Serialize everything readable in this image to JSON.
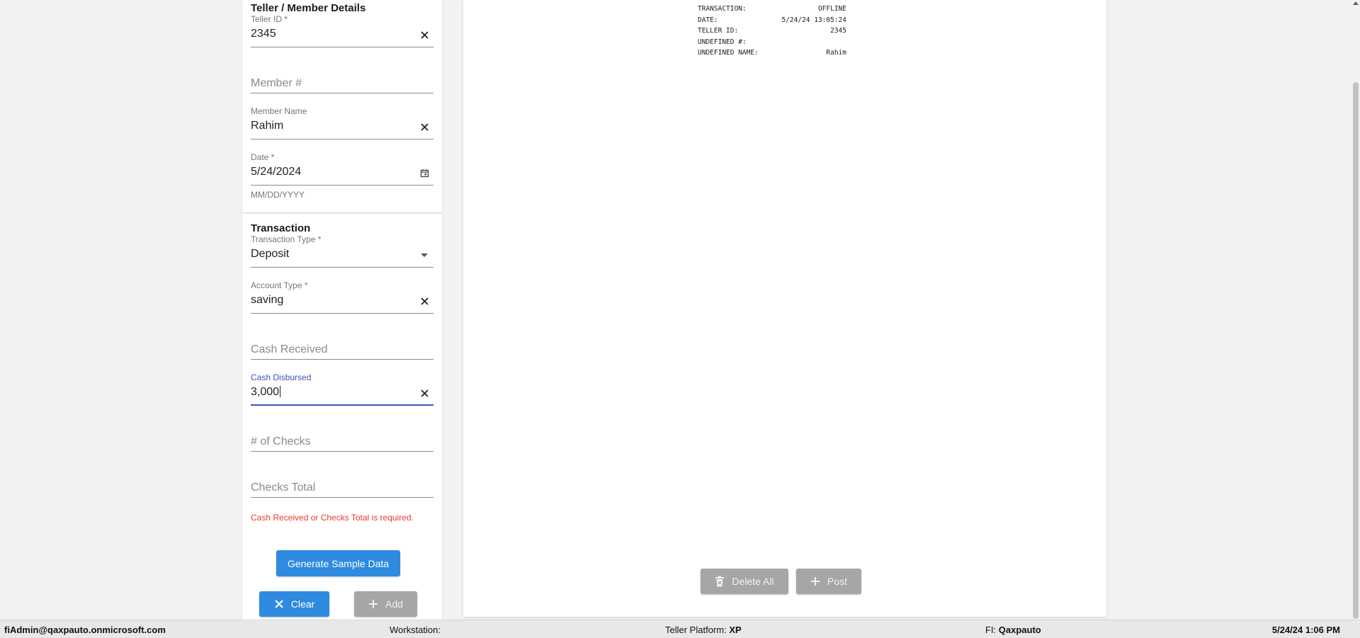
{
  "teller_section": {
    "title": "Teller / Member Details",
    "teller_id": {
      "label": "Teller ID *",
      "value": "2345"
    },
    "member_number": {
      "placeholder": "Member #"
    },
    "member_name": {
      "label": "Member Name",
      "value": "Rahim"
    },
    "date": {
      "label": "Date *",
      "value": "5/24/2024",
      "helper": "MM/DD/YYYY"
    }
  },
  "transaction_section": {
    "title": "Transaction",
    "transaction_type": {
      "label": "Transaction Type *",
      "value": "Deposit"
    },
    "account_type": {
      "label": "Account Type *",
      "value": "saving"
    },
    "cash_received": {
      "placeholder": "Cash Received"
    },
    "cash_disbursed": {
      "label": "Cash Disbursed",
      "value": "3,000"
    },
    "num_checks": {
      "placeholder": "# of Checks"
    },
    "checks_total": {
      "placeholder": "Checks Total"
    },
    "error": "Cash Received or Checks Total is required."
  },
  "buttons": {
    "generate": "Generate Sample Data",
    "clear": "Clear",
    "add": "Add",
    "delete_all": "Delete All",
    "post": "Post"
  },
  "receipt": {
    "rows": [
      {
        "key": "TRANSACTION:",
        "value": "OFFLINE"
      },
      {
        "key": "DATE:",
        "value": "5/24/24 13:05:24"
      },
      {
        "key": "TELLER ID:",
        "value": "2345"
      },
      {
        "key": "UNDEFINED #:",
        "value": ""
      },
      {
        "key": "UNDEFINED NAME:",
        "value": "Rahim"
      }
    ]
  },
  "status_bar": {
    "user": "fiAdmin@qaxpauto.onmicrosoft.com",
    "workstation_label": "Workstation:",
    "workstation_value": "",
    "platform_label": "Teller Platform:",
    "platform_value": "XP",
    "fi_label": "FI:",
    "fi_value": "Qaxpauto",
    "datetime": "5/24/24 1:06 PM"
  },
  "colors": {
    "primary": "#2e8be0",
    "focus": "#3f51b5",
    "error": "#e53935",
    "disabled": "#a6a6a6"
  }
}
